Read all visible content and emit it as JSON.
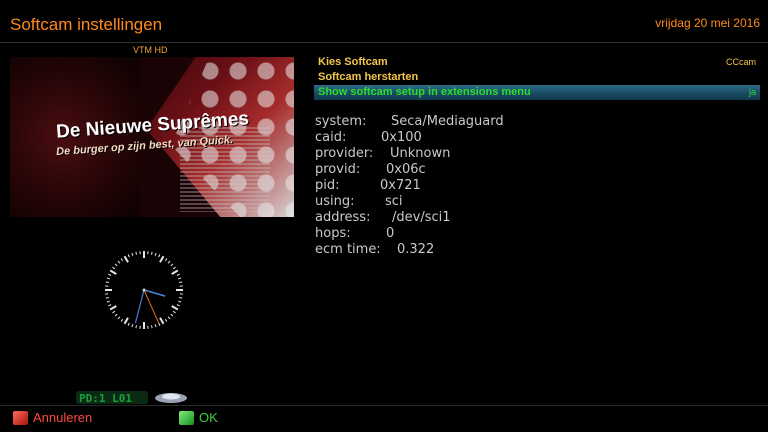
{
  "header": {
    "title": "Softcam instellingen",
    "date": "vrijdag 20 mei 2016"
  },
  "preview": {
    "channel": "VTM HD",
    "ad_line1": "De Nieuwe Suprêmes",
    "ad_line2": "De burger op zijn best, van Quick."
  },
  "clock": {
    "hour": 3,
    "minute": 32,
    "second": 26
  },
  "menu": {
    "items": [
      {
        "label": "Kies Softcam",
        "value": "CCcam",
        "selected": false
      },
      {
        "label": "Softcam herstarten",
        "value": "",
        "selected": false
      },
      {
        "label": "Show softcam setup in extensions menu",
        "value": "ja",
        "selected": true
      }
    ]
  },
  "info": [
    {
      "key": "system:",
      "value": "Seca/Mediaguard"
    },
    {
      "key": "caid:",
      "value": "0x100"
    },
    {
      "key": "provider:",
      "value": "Unknown"
    },
    {
      "key": "provid:",
      "value": "0x06c"
    },
    {
      "key": "pid:",
      "value": "0x721"
    },
    {
      "key": "using:",
      "value": "sci"
    },
    {
      "key": "address:",
      "value": "/dev/sci1"
    },
    {
      "key": "hops:",
      "value": "0"
    },
    {
      "key": "ecm time:",
      "value": "0.322"
    }
  ],
  "badge": {
    "text": "PD:1  L01"
  },
  "footer": {
    "red_label": "Annuleren",
    "green_label": "OK"
  },
  "colors": {
    "title": "#ff8a1a",
    "menu_text": "#f2c64a",
    "selected_text": "#2dde2d",
    "selected_bar": "#184a62",
    "red_key": "#ff4a3a",
    "green_key": "#35d13a"
  }
}
